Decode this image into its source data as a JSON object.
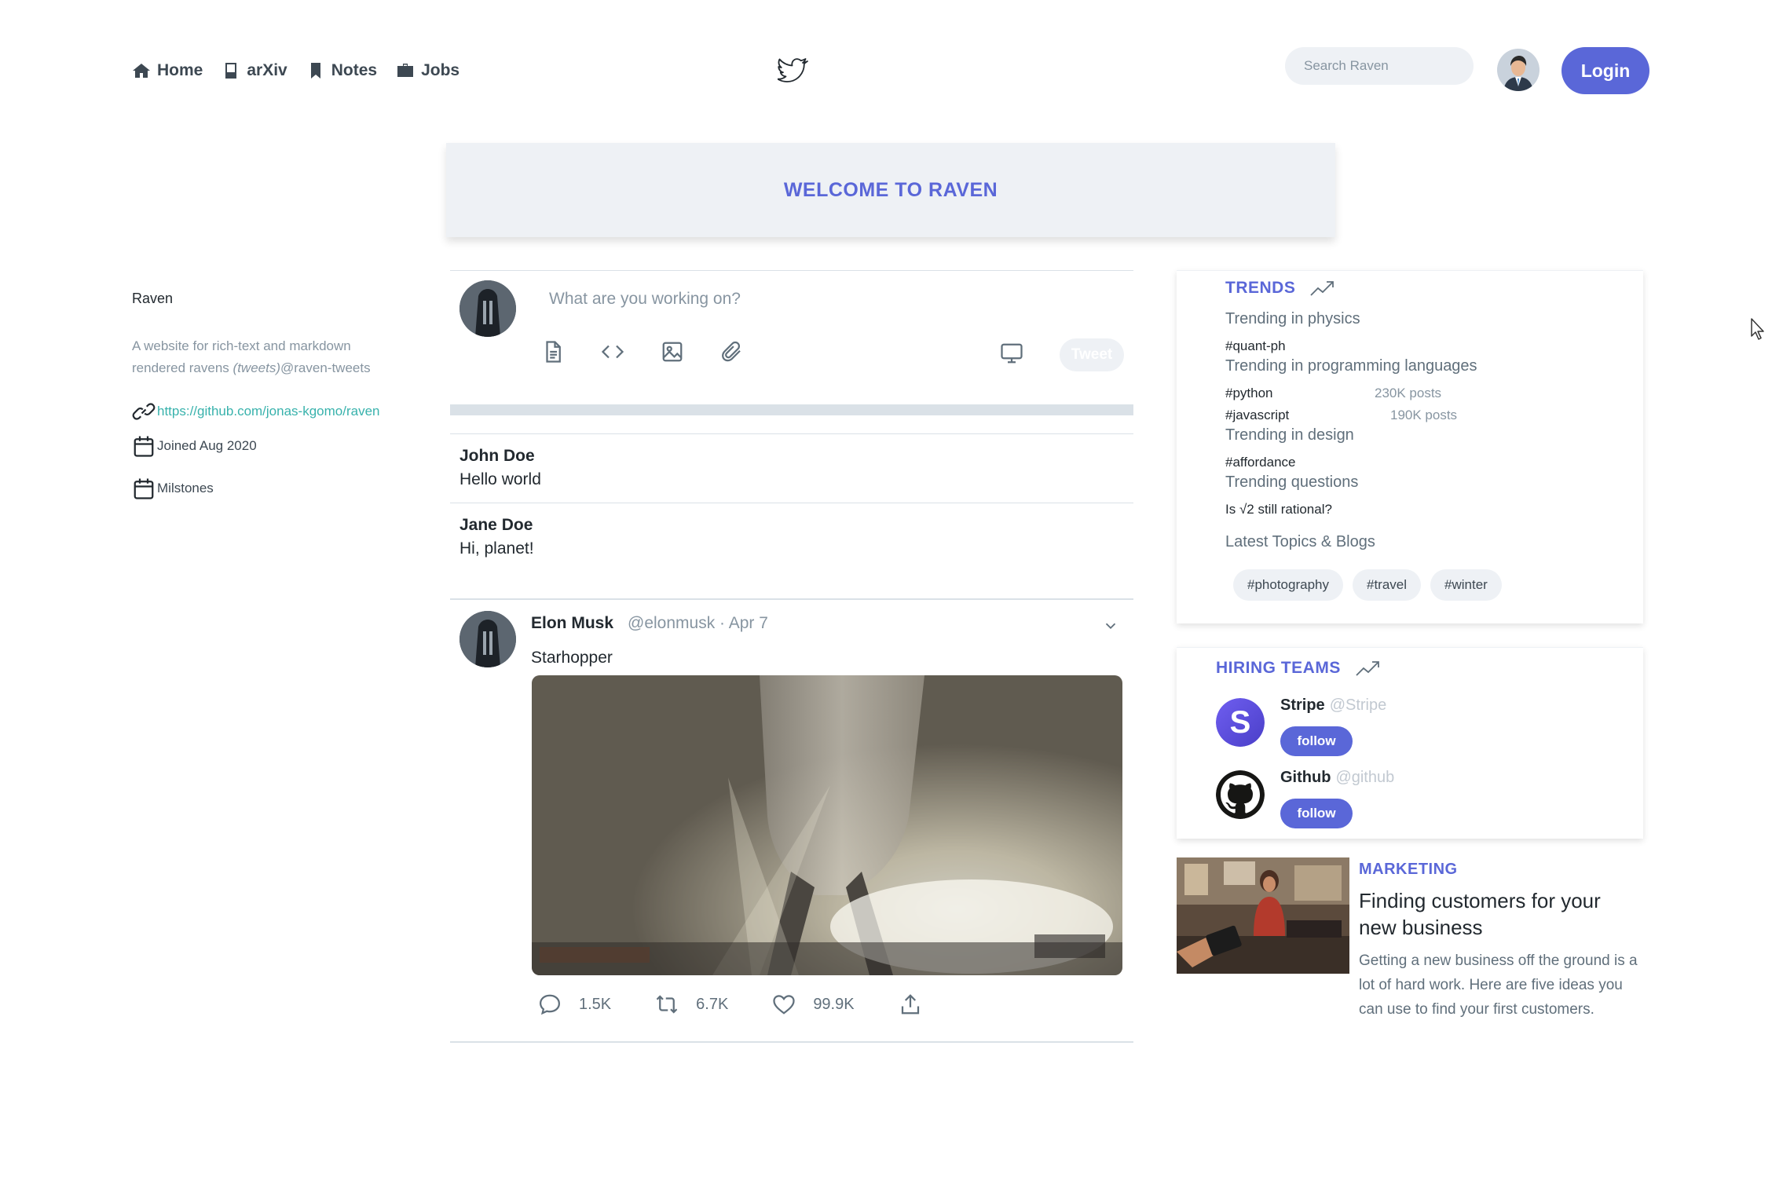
{
  "nav": {
    "links": [
      {
        "label": "Home",
        "icon": "home-icon"
      },
      {
        "label": "arXiv",
        "icon": "book-icon"
      },
      {
        "label": "Notes",
        "icon": "bookmark-icon"
      },
      {
        "label": "Jobs",
        "icon": "briefcase-icon"
      }
    ],
    "search_placeholder": "Search Raven",
    "login_label": "Login"
  },
  "banner": {
    "title": "WELCOME TO RAVEN"
  },
  "profile": {
    "name": "Raven",
    "description_prefix": "A website for rich-text and markdown rendered ravens ",
    "description_em": "(tweets)",
    "description_suffix": "@raven-tweets",
    "link": "https://github.com/jonas-kgomo/raven",
    "joined": "Joined Aug 2020",
    "milestones": "Milstones"
  },
  "composer": {
    "placeholder": "What are you working on?",
    "tweet_label": "Tweet"
  },
  "posts": [
    {
      "name": "John Doe",
      "text": "Hello world"
    },
    {
      "name": "Jane Doe",
      "text": "Hi, planet!"
    }
  ],
  "tweet": {
    "name": "Elon Musk",
    "handle_date": "@elonmusk · Apr 7",
    "text": "Starhopper",
    "replies": "1.5K",
    "retweets": "6.7K",
    "likes": "99.9K"
  },
  "trends": {
    "title": "TRENDS",
    "groups": [
      {
        "category": "Trending in physics",
        "items": [
          {
            "tag": "#quant-ph",
            "count": ""
          }
        ]
      },
      {
        "category": "Trending in programming languages",
        "items": [
          {
            "tag": "#python",
            "count": "230K posts"
          },
          {
            "tag": "#javascript",
            "count": "190K posts"
          }
        ]
      },
      {
        "category": "Trending in design",
        "items": [
          {
            "tag": "#affordance",
            "count": ""
          }
        ]
      },
      {
        "category": "Trending questions",
        "items": [
          {
            "tag": "Is √2 still rational?",
            "count": ""
          }
        ]
      }
    ],
    "latest_label": "Latest Topics & Blogs",
    "chips": [
      "#photography",
      "#travel",
      "#winter"
    ]
  },
  "hiring": {
    "title": "HIRING TEAMS",
    "companies": [
      {
        "name": "Stripe",
        "handle": "@Stripe",
        "follow": "follow"
      },
      {
        "name": "Github",
        "handle": "@github",
        "follow": "follow"
      }
    ]
  },
  "marketing": {
    "kicker": "MARKETING",
    "headline": "Finding customers for your new business",
    "description": "Getting a new business off the ground is a lot of hard work. Here are five ideas you can use to find your first customers."
  },
  "colors": {
    "accent": "#5a67d8",
    "link": "#38b2ac",
    "muted": "#8795a1"
  }
}
